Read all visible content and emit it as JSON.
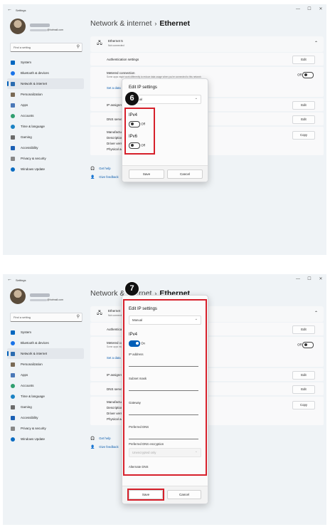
{
  "screen1": {
    "app": {
      "title": "Settings",
      "back_icon": "arrow-left-icon",
      "window_controls": [
        "—",
        "☐",
        "✕"
      ]
    },
    "account": {
      "email": "@hotmail.com"
    },
    "search": {
      "placeholder": "Find a setting"
    },
    "nav": [
      {
        "label": "System",
        "color": "#0067c0"
      },
      {
        "label": "Bluetooth & devices",
        "color": "#1a73e8"
      },
      {
        "label": "Network & internet",
        "color": "#2b6cb0",
        "active": true
      },
      {
        "label": "Personalization",
        "color": "#7a6a55"
      },
      {
        "label": "Apps",
        "color": "#4a78b8"
      },
      {
        "label": "Accounts",
        "color": "#2f9e6e"
      },
      {
        "label": "Time & language",
        "color": "#1a82c4"
      },
      {
        "label": "Gaming",
        "color": "#6b6b6b"
      },
      {
        "label": "Accessibility",
        "color": "#1a5fb4"
      },
      {
        "label": "Privacy & security",
        "color": "#888888"
      },
      {
        "label": "Windows Update",
        "color": "#0a6cc2"
      }
    ],
    "breadcrumb": {
      "parent": "Network & internet",
      "sep": "›",
      "current": "Ethernet"
    },
    "ethernet": {
      "name": "Ethernet 5",
      "status": "Not connected"
    },
    "rows": {
      "auth": {
        "label": "Authentication settings",
        "button": "Edit"
      },
      "metered": {
        "label": "Metered connection",
        "sub": "Some apps might work differently to reduce data usage when you're connected to this network",
        "state": "Off"
      },
      "data_limit": "Set a data limit",
      "ip_assign": {
        "label": "IP assignment:",
        "button": "Edit"
      },
      "dns": {
        "label": "DNS server assignment:",
        "button": "Edit"
      },
      "props": {
        "labels": [
          "Manufacturer:",
          "Description:",
          "Driver version:",
          "Physical address (MAC):"
        ],
        "button": "Copy"
      }
    },
    "help": {
      "get_help": "Get help",
      "feedback": "Give feedback"
    },
    "dialog": {
      "title": "Edit IP settings",
      "dropdown_value": "Manual",
      "ipv4": {
        "label": "IPv4",
        "state": "Off"
      },
      "ipv6": {
        "label": "IPv6",
        "state": "Off"
      },
      "save": "Save",
      "cancel": "Cancel"
    },
    "step": "6"
  },
  "screen2": {
    "app": {
      "title": "Settings",
      "back_icon": "arrow-left-icon",
      "window_controls": [
        "—",
        "☐",
        "✕"
      ]
    },
    "account": {
      "email": "@hotmail.com"
    },
    "search": {
      "placeholder": "Find a setting"
    },
    "nav": [
      {
        "label": "System",
        "color": "#0067c0"
      },
      {
        "label": "Bluetooth & devices",
        "color": "#1a73e8"
      },
      {
        "label": "Network & internet",
        "color": "#2b6cb0",
        "active": true
      },
      {
        "label": "Personalization",
        "color": "#7a6a55"
      },
      {
        "label": "Apps",
        "color": "#4a78b8"
      },
      {
        "label": "Accounts",
        "color": "#2f9e6e"
      },
      {
        "label": "Time & language",
        "color": "#1a82c4"
      },
      {
        "label": "Gaming",
        "color": "#6b6b6b"
      },
      {
        "label": "Accessibility",
        "color": "#1a5fb4"
      },
      {
        "label": "Privacy & security",
        "color": "#888888"
      },
      {
        "label": "Windows Update",
        "color": "#0a6cc2"
      }
    ],
    "breadcrumb": {
      "parent": "Network & internet",
      "sep": "›",
      "current": "Ethernet"
    },
    "ethernet": {
      "name": "Ethernet",
      "status": "Not connected"
    },
    "rows": {
      "auth": {
        "label": "Authentication settings",
        "button": "Edit"
      },
      "metered": {
        "label": "Metered connection",
        "sub": "Some apps might work differently to reduce data usage when you're connected to this network",
        "state": "Off"
      },
      "data_limit": "Set a data limit",
      "ip_assign": {
        "label": "IP assignment:",
        "button": "Edit"
      },
      "dns": {
        "label": "DNS server assignment:",
        "button": "Edit"
      },
      "props": {
        "labels": [
          "Manufacturer:",
          "Description:",
          "Driver version:",
          "Physical address (MAC):"
        ],
        "button": "Copy"
      }
    },
    "help": {
      "get_help": "Get help",
      "feedback": "Give feedback"
    },
    "dialog": {
      "title": "Edit IP settings",
      "dropdown_value": "Manual",
      "ipv4": {
        "label": "IPv4",
        "state": "On"
      },
      "fields": [
        "IP address",
        "Subnet mask",
        "Gateway",
        "Preferred DNS",
        "Preferred DNS encryption",
        "Alternate DNS"
      ],
      "encryption_value": "Unencrypted only",
      "save": "Save",
      "cancel": "Cancel"
    },
    "step": "7"
  }
}
